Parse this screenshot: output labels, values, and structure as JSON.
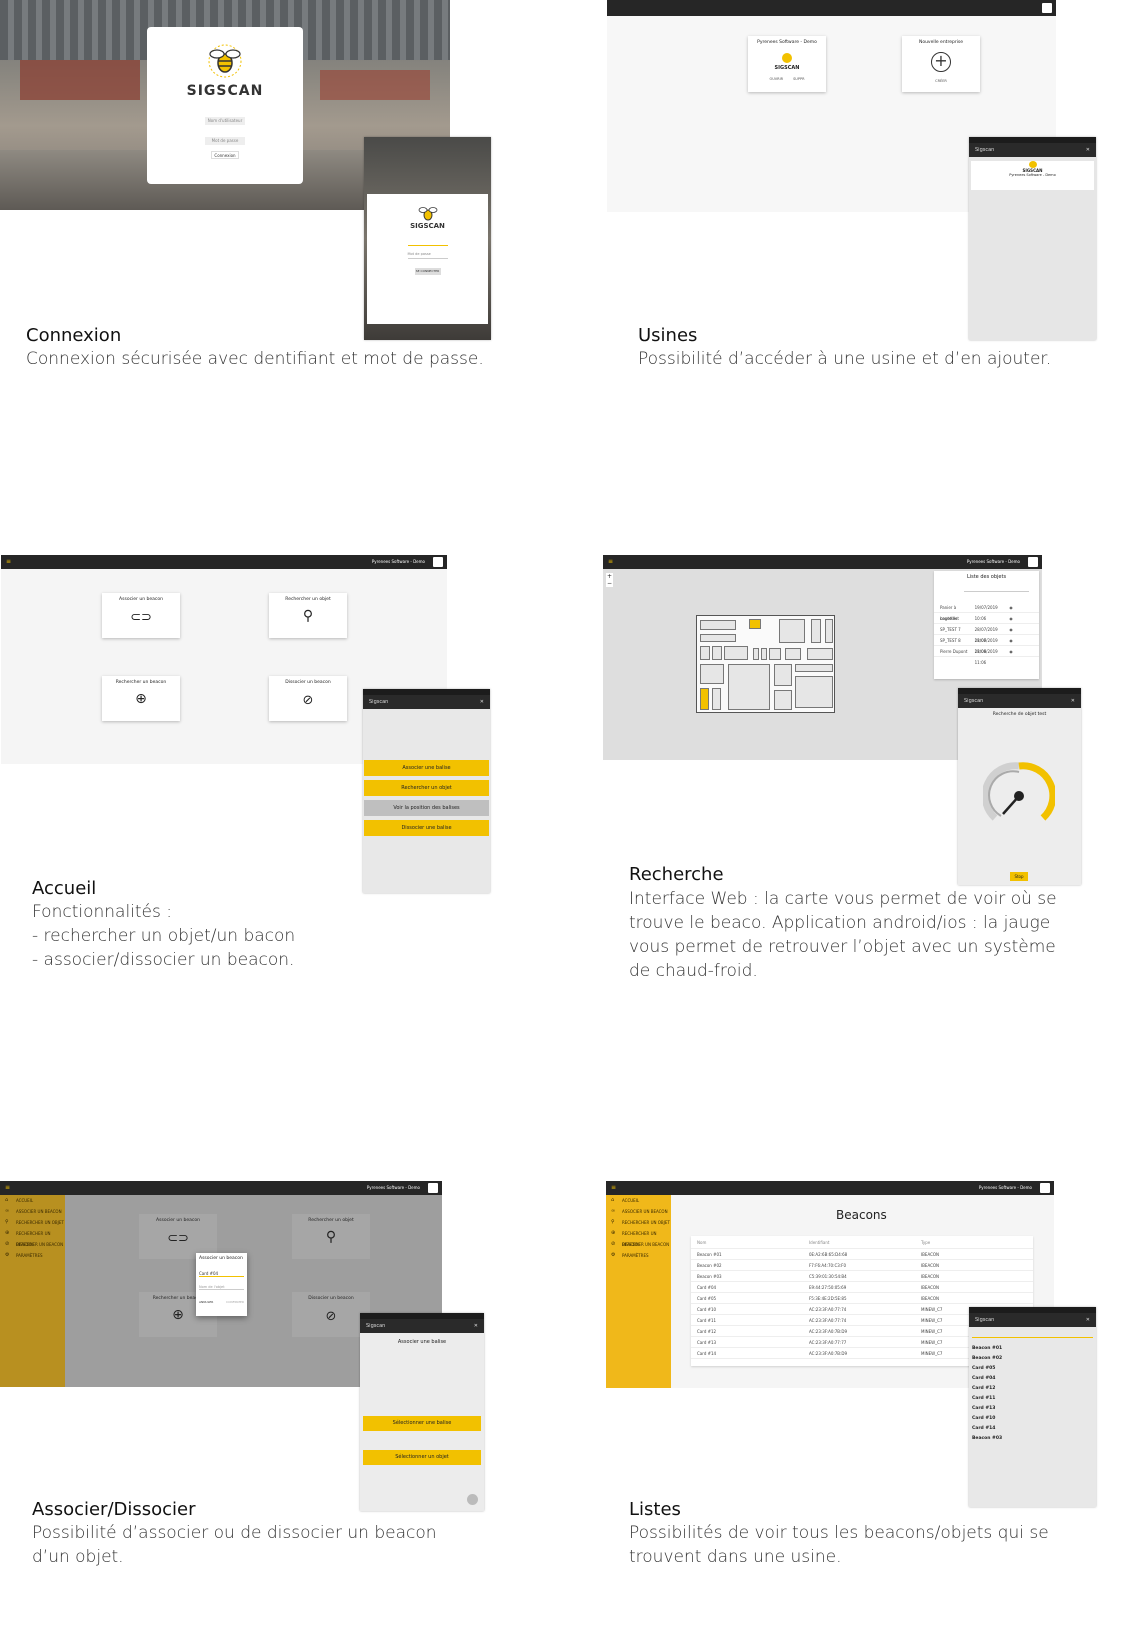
{
  "sections": {
    "connexion": {
      "title": "Connexion",
      "text": "Connexion sécurisée avec  dentifiant et mot de passe."
    },
    "usines": {
      "title": "Usines",
      "text": "Possibilité d’accéder à une usine et d’en ajouter."
    },
    "accueil": {
      "title": "Accueil",
      "text": "Fonctionnalités :\n- rechercher un objet/un bacon\n- associer/dissocier un beacon."
    },
    "recherche": {
      "title": "Recherche",
      "text": "Interface Web : la carte vous permet de voir où se\ntrouve le beaco. Application android/ios : la jauge\nvous permet de retrouver l’objet avec un système\nde chaud-froid."
    },
    "associer": {
      "title": "Associer/Dissocier",
      "text": "Possibilité d’associer ou de  dissocier un beacon\nd’un objet."
    },
    "listes": {
      "title": "Listes",
      "text": "Possibilités de voir tous les  beacons/objets qui se\ntrouvent dans une usine."
    }
  },
  "login": {
    "brand": "SIGSCAN",
    "user_placeholder": "Nom d'utilisateur",
    "pass_placeholder": "Mot de passe",
    "button": "Connexion",
    "mobile_pass": "Mot de passe",
    "mobile_button": "SE CONNECTER"
  },
  "factories": {
    "card1_title": "Pyrenees Software - Demo",
    "card1_brand": "SIGSCAN",
    "card1_open": "OUVRIR",
    "card1_delete": "SUPPR",
    "card2_title": "Nouvelle entreprise",
    "card2_action": "CRÉER",
    "mobile_header": "Sigscan",
    "mobile_brand": "SIGSCAN",
    "mobile_company": "Pyrenees Software - Demo"
  },
  "home": {
    "company": "Pyrenees Software - Demo",
    "tiles": [
      "Associer un beacon",
      "Rechercher un objet",
      "Rechercher un beacon",
      "Dissocier un beacon"
    ],
    "mobile_header": "Sigscan",
    "mobile_buttons": [
      "Associer une balise",
      "Rechercher un objet",
      "Voir la position des balises",
      "Dissocier une balise"
    ]
  },
  "search": {
    "company": "Pyrenees Software - Demo",
    "list_title": "Liste des objets",
    "list_rows": [
      [
        "Panier à bouteille",
        "19/07/2019 10:06"
      ],
      [
        "cagettest",
        ""
      ],
      [
        "SP_TEST 7",
        "28/07/2019 11:06"
      ],
      [
        "SP_TEST 8",
        "28/07/2019 11:06"
      ],
      [
        "Pierre Dupont",
        "28/08/2019 11:06"
      ]
    ],
    "map_zoom": [
      "+",
      "−"
    ],
    "mobile_header": "Sigscan",
    "mobile_title": "Recherche de objet test",
    "mobile_stop": "Stop"
  },
  "assoc": {
    "company": "Pyrenees Software - Demo",
    "menu": [
      "ACCUEIL",
      "ASSOCIER UN BEACON",
      "RECHERCHER UN OBJET",
      "RECHERCHER UN BEACON",
      "DISSOCIER UN BEACON",
      "PARAMÈTRES"
    ],
    "tiles": [
      "Associer un beacon",
      "Rechercher un objet",
      "Rechercher un beacon",
      "Dissocier un beacon"
    ],
    "dialog_title": "Associer un beacon",
    "dialog_field": "Card #04",
    "dialog_field2": "Nom de l'objet",
    "dialog_cancel": "ANNULER",
    "dialog_ok": "CONFIRMER",
    "mobile_header": "Sigscan",
    "mobile_title": "Associer une balise",
    "mobile_btn1": "Sélectionner une balise",
    "mobile_btn2": "Sélectionner un objet"
  },
  "lists": {
    "company": "Pyrenees Software - Demo",
    "menu": [
      "ACCUEIL",
      "ASSOCIER UN BEACON",
      "RECHERCHER UN OBJET",
      "RECHERCHER UN BEACON",
      "DISSOCIER UN BEACON",
      "PARAMÈTRES"
    ],
    "page_title": "Beacons",
    "columns": [
      "Nom",
      "Identifiant",
      "Type"
    ],
    "rows": [
      [
        "Beacon #01",
        "0E:A2:6B:65:D4:68",
        "IBEACON"
      ],
      [
        "Beacon #02",
        "F7:F6:A4:70:C3:F0",
        "IBEACON"
      ],
      [
        "Beacon #03",
        "C5:39:01:30:54:B4",
        "IBEACON"
      ],
      [
        "Card #04",
        "E9:44:27:50:05:69",
        "IBEACON"
      ],
      [
        "Card #05",
        "F5:3E:4E:2D:5E:85",
        "IBEACON"
      ],
      [
        "Card #10",
        "AC:23:3F:A0:77:74",
        "MINEW_C7"
      ],
      [
        "Card #11",
        "AC:23:3F:A0:77:74",
        "MINEW_C7"
      ],
      [
        "Card #12",
        "AC:23:3F:A0:7B:D9",
        "MINEW_C7"
      ],
      [
        "Card #13",
        "AC:23:3F:A0:77:77",
        "MINEW_C7"
      ],
      [
        "Card #14",
        "AC:23:3F:A0:7B:D9",
        "MINEW_C7"
      ]
    ],
    "mobile_header": "Sigscan",
    "mobile_items": [
      "Beacon #01",
      "Beacon #02",
      "Card #05",
      "Card #04",
      "Card #12",
      "Card #11",
      "Card #13",
      "Card #10",
      "Card #14",
      "Beacon #03"
    ]
  },
  "colors": {
    "accent": "#f2c100",
    "dark": "#262626",
    "sidebar": "#f0b81a"
  }
}
